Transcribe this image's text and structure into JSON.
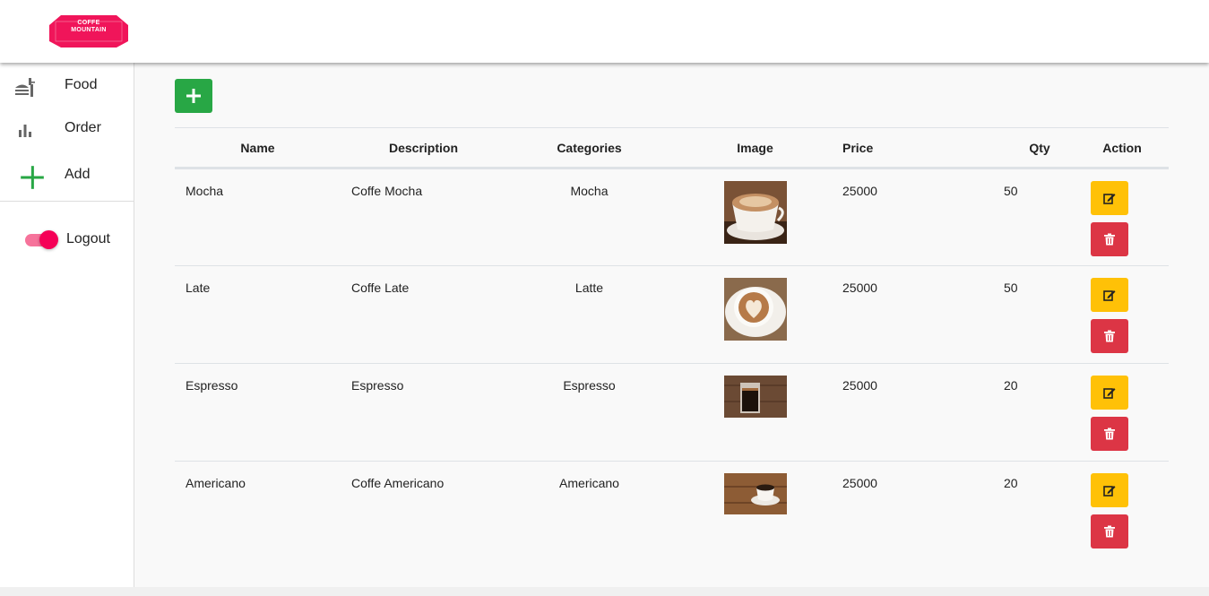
{
  "brand": {
    "line1": "COFFE",
    "line2": "MOUNTAIN",
    "color": "#f0155a"
  },
  "sidebar": {
    "items": [
      {
        "label": "Food",
        "icon": "food-icon"
      },
      {
        "label": "Order",
        "icon": "bar-chart-icon"
      },
      {
        "label": "Add",
        "icon": "plus-icon"
      }
    ],
    "logout_label": "Logout",
    "logout_toggle_on": true
  },
  "toolbar": {
    "add_icon": "plus-icon",
    "add_color": "#28a745"
  },
  "table": {
    "columns": [
      "Name",
      "Description",
      "Categories",
      "Image",
      "Price",
      "Qty",
      "Action"
    ],
    "rows": [
      {
        "name": "Mocha",
        "description": "Coffe Mocha",
        "category": "Mocha",
        "image": "mocha-coffee-photo",
        "price": "25000",
        "qty": "50"
      },
      {
        "name": "Late",
        "description": "Coffe Late",
        "category": "Latte",
        "image": "latte-art-photo",
        "price": "25000",
        "qty": "50"
      },
      {
        "name": "Espresso",
        "description": "Espresso",
        "category": "Espresso",
        "image": "espresso-glass-photo",
        "price": "25000",
        "qty": "20"
      },
      {
        "name": "Americano",
        "description": "Coffe Americano",
        "category": "Americano",
        "image": "americano-cup-photo",
        "price": "25000",
        "qty": "20"
      }
    ],
    "edit_icon": "edit-icon",
    "delete_icon": "trash-icon",
    "edit_color": "#ffc107",
    "delete_color": "#dc3545"
  }
}
